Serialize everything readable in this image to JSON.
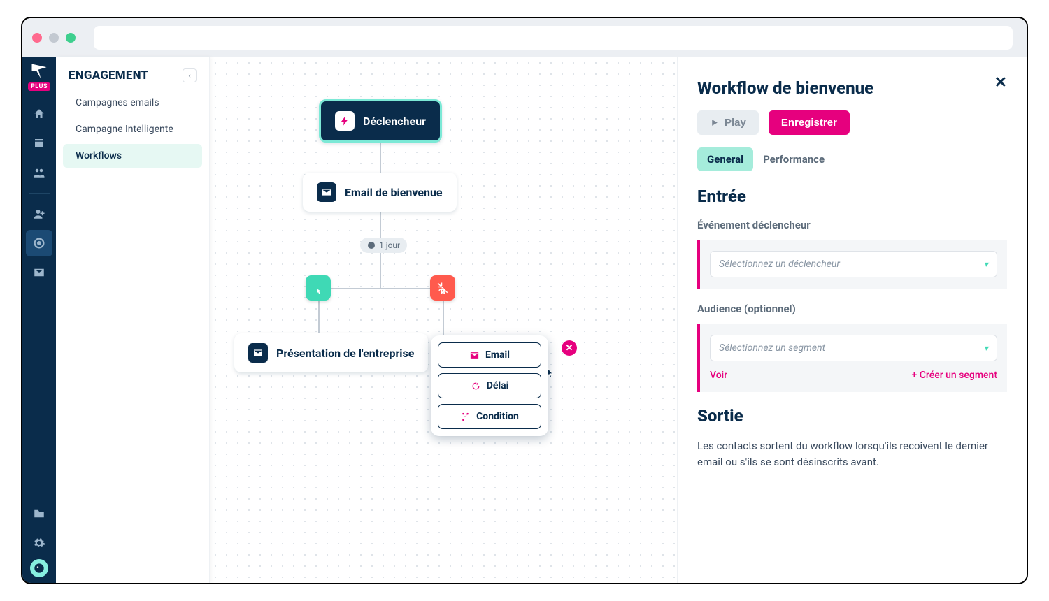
{
  "browser": {
    "plus_badge": "PLUS"
  },
  "subnav": {
    "title": "ENGAGEMENT",
    "items": [
      "Campagnes emails",
      "Campagne Intelligente",
      "Workflows"
    ],
    "active_index": 2
  },
  "workflow": {
    "trigger_label": "Déclencheur",
    "email1_label": "Email de bienvenue",
    "delay_label": "1 jour",
    "email2_label": "Présentation de l'entreprise",
    "action_menu": {
      "email": "Email",
      "delay": "Délai",
      "condition": "Condition"
    }
  },
  "panel": {
    "title": "Workflow de bienvenue",
    "play": "Play",
    "save": "Enregistrer",
    "tabs": {
      "general": "General",
      "performance": "Performance"
    },
    "section_entry": "Entrée",
    "trigger_label": "Événement déclencheur",
    "trigger_placeholder": "Sélectionnez un déclencheur",
    "audience_label": "Audience (optionnel)",
    "audience_placeholder": "Sélectionnez un segment",
    "link_view": "Voir",
    "link_create": "+ Créer un segment",
    "section_exit": "Sortie",
    "exit_text": "Les contacts sortent du workflow lorsqu'ils recoivent le dernier email ou s'ils se sont désinscrits avant."
  }
}
